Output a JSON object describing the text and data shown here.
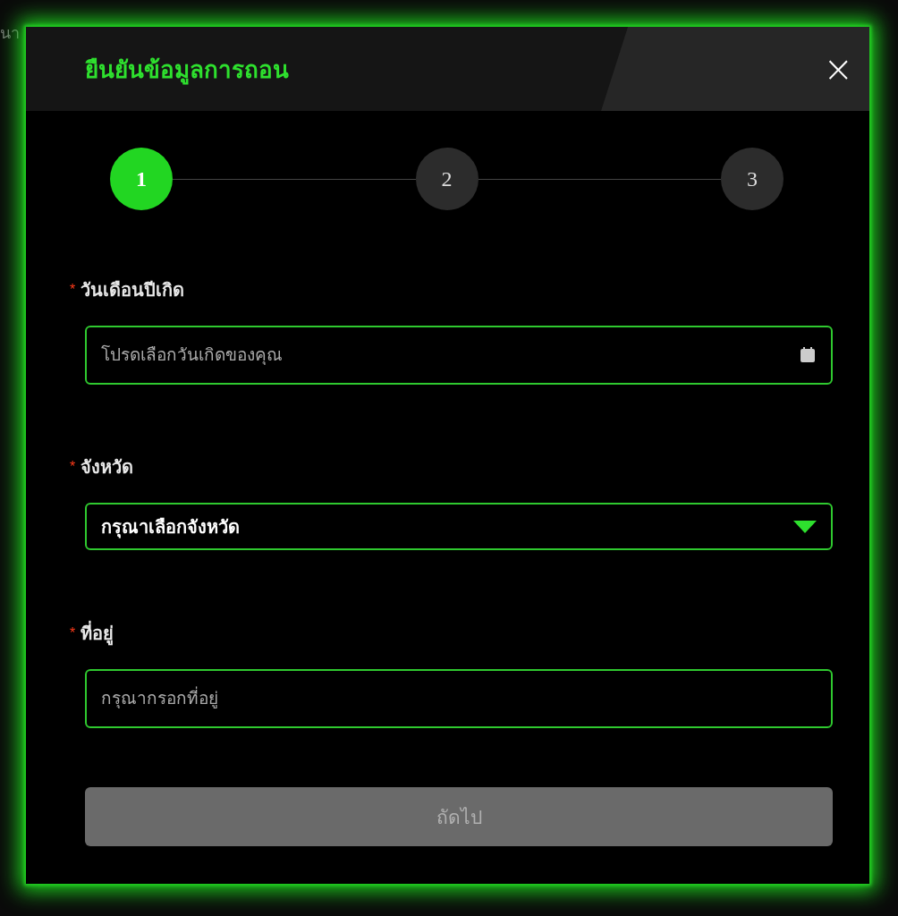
{
  "backdrop_text": "นา",
  "dialog": {
    "title": "ยืนยันข้อมูลการถอน",
    "close": "×"
  },
  "steps": [
    {
      "label": "1",
      "selected": true
    },
    {
      "label": "2",
      "selected": false
    },
    {
      "label": "3",
      "selected": false
    }
  ],
  "fields": [
    {
      "kind": "date",
      "label": "วันเดือนปีเกิด",
      "required_mark": "*",
      "placeholder": "โปรดเลือกวันเกิดของคุณ"
    },
    {
      "kind": "select",
      "label": "จังหวัด",
      "required_mark": "*",
      "value": "กรุณาเลือกจังหวัด"
    },
    {
      "kind": "text",
      "label": "ที่อยู่",
      "required_mark": "*",
      "placeholder": "กรุณากรอกที่อยู่"
    }
  ],
  "next_button": {
    "label": "ถัดไป",
    "disabled": true
  }
}
